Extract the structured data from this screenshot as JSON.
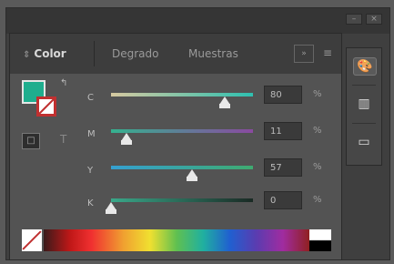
{
  "window": {
    "minimize_glyph": "–",
    "close_glyph": "×"
  },
  "tabs": {
    "color_label": "Color",
    "color_mark": "⇕",
    "degrade_label": "Degrado",
    "muestras_label": "Muestras",
    "expand_glyph": "»",
    "menu_glyph": "≡"
  },
  "swatches": {
    "fill_color": "#1fae8e",
    "stroke_color": "#c03030",
    "swap_glyph": "↰",
    "mode_glyph": "□",
    "mode_t_glyph": "T"
  },
  "sliders": [
    {
      "label": "C",
      "value": "80",
      "percent_sign": "%",
      "fraction": 0.8,
      "gradient": [
        "#d6c9a0",
        "#2ec0b0"
      ]
    },
    {
      "label": "M",
      "value": "11",
      "percent_sign": "%",
      "fraction": 0.11,
      "gradient": [
        "#35b18f",
        "#8a4aa0"
      ]
    },
    {
      "label": "Y",
      "value": "57",
      "percent_sign": "%",
      "fraction": 0.57,
      "gradient": [
        "#35a0d0",
        "#3eaa70"
      ]
    },
    {
      "label": "K",
      "value": "0",
      "percent_sign": "%",
      "fraction": 0.0,
      "gradient": [
        "#3aa88a",
        "#1a2a24"
      ]
    }
  ],
  "sidebar": {
    "icons": [
      "palette-icon",
      "swatches-icon",
      "stroke-icon"
    ],
    "glyphs": [
      "🎨",
      "▥",
      "▭"
    ]
  }
}
